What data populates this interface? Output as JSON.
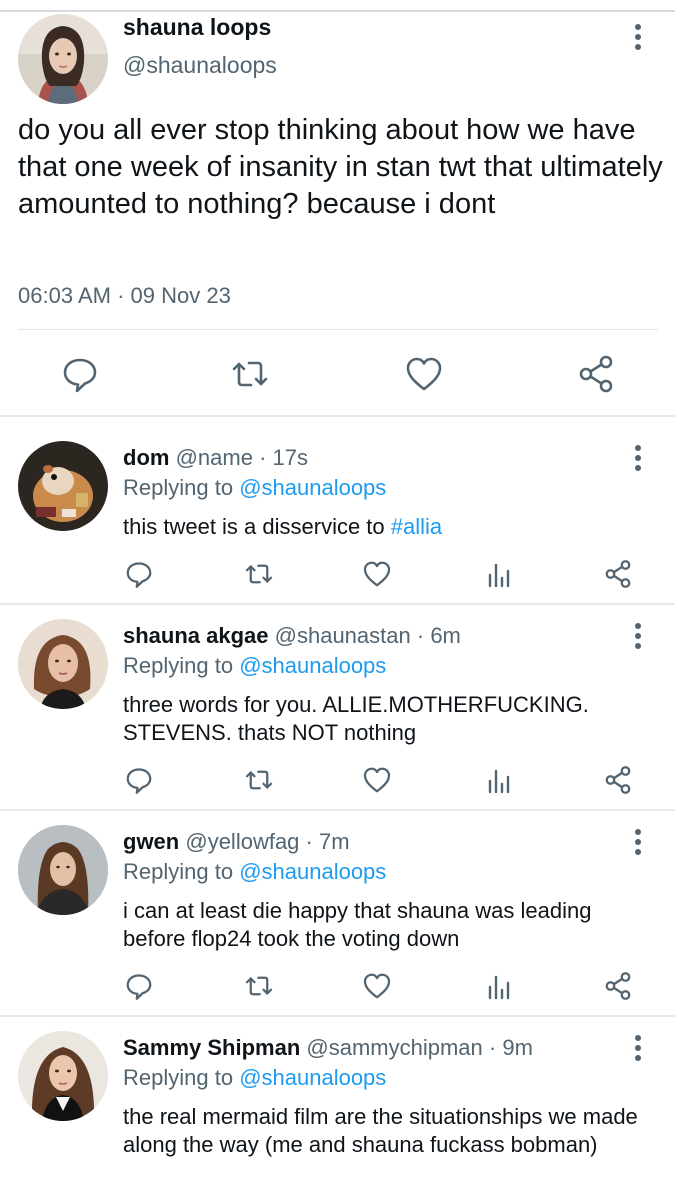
{
  "main_tweet": {
    "display_name": "shauna loops",
    "handle": "@shaunaloops",
    "text": "do you all ever stop thinking about how we have that one week of insanity in stan twt that ultimately amounted to nothing? because i dont",
    "time": "06:03 AM",
    "separator": "·",
    "date": "09 Nov 23",
    "actions": [
      "reply-icon",
      "retweet-icon",
      "like-icon",
      "share-icon"
    ]
  },
  "replies": [
    {
      "display_name": "dom",
      "handle": "@name",
      "time": "17s",
      "replying_prefix": "Replying to ",
      "replying_to": "@shaunaloops",
      "text": "this tweet is a disservice to ",
      "hashtag": "#allia"
    },
    {
      "display_name": "shauna akgae",
      "handle": "@shaunastan",
      "time": "6m",
      "replying_prefix": "Replying to ",
      "replying_to": "@shaunaloops",
      "text": "three words for you. ALLIE.MOTHERFUCKING. STEVENS. thats NOT nothing"
    },
    {
      "display_name": "gwen",
      "handle": "@yellowfag",
      "time": "7m",
      "replying_prefix": "Replying to ",
      "replying_to": "@shaunaloops",
      "text": "i can at least die happy that shauna was leading before flop24 took the voting down"
    },
    {
      "display_name": "Sammy Shipman",
      "handle": "@sammychipman",
      "time": "9m",
      "replying_prefix": "Replying to ",
      "replying_to": "@shaunaloops",
      "text": "the real mermaid film are the situationships we made along the way (me and shauna fuckass bobman)"
    }
  ],
  "dot": "·",
  "colors": {
    "link": "#1d9bf0",
    "muted": "#536471",
    "icon": "#536471"
  }
}
